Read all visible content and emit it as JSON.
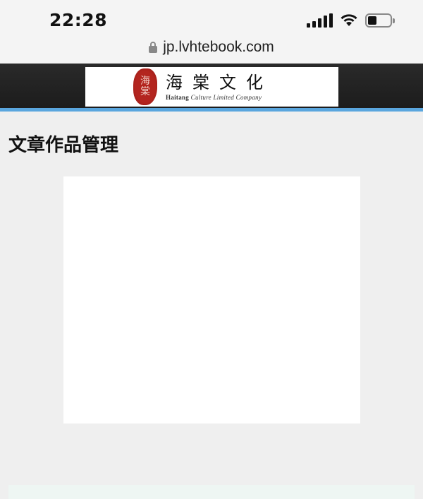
{
  "status_bar": {
    "time": "22:28"
  },
  "browser": {
    "url": "jp.lvhtebook.com"
  },
  "header": {
    "logo_seal_text": [
      "海",
      "棠"
    ],
    "logo_cn": "海棠文化",
    "logo_en_bold": "Haitang",
    "logo_en_rest": "Culture Limited Company"
  },
  "content": {
    "page_title": "文章作品管理"
  },
  "colors": {
    "accent_line": "#5aa6de",
    "header_bg": "#222222",
    "seal_red": "#b3251f"
  }
}
